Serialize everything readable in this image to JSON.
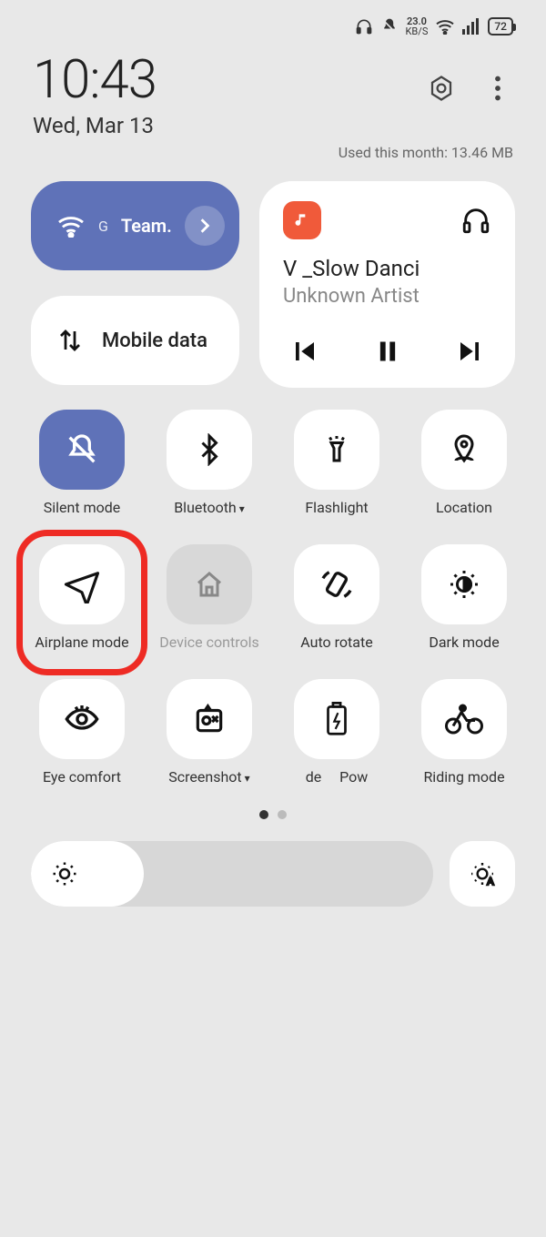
{
  "status": {
    "speed_value": "23.0",
    "speed_unit": "KB/S",
    "battery": "72"
  },
  "header": {
    "time": "10:43",
    "date": "Wed, Mar 13",
    "data_usage": "Used this month: 13.46 MB"
  },
  "wifi": {
    "network_type": "G",
    "network_name": "Team."
  },
  "mobile_data": {
    "label": "Mobile data"
  },
  "media": {
    "title": "V _Slow Danci",
    "artist": "Unknown Artist"
  },
  "tiles": [
    {
      "label": "Silent mode"
    },
    {
      "label": "Bluetooth",
      "dropdown": true
    },
    {
      "label": "Flashlight"
    },
    {
      "label": "Location"
    },
    {
      "label": "Airplane mode"
    },
    {
      "label": "Device controls"
    },
    {
      "label": "Auto rotate"
    },
    {
      "label": "Dark mode"
    },
    {
      "label": "Eye comfort"
    },
    {
      "label": "Screenshot",
      "dropdown": true
    },
    {
      "label_prefix": "de",
      "label_mid": "Pow"
    },
    {
      "label": "Riding mode"
    }
  ]
}
